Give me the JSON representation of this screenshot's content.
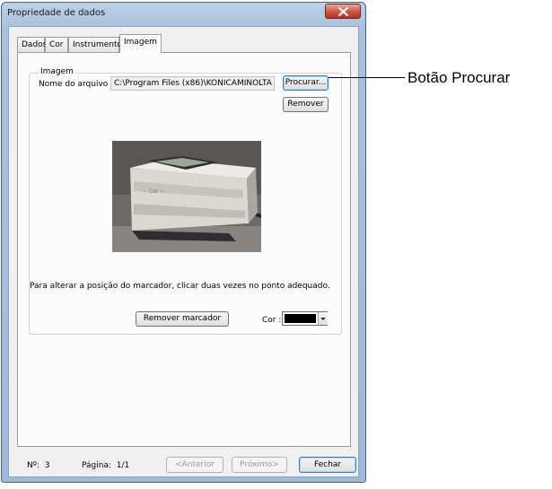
{
  "window": {
    "title": "Propriedade de dados",
    "close_icon": "close-x-icon"
  },
  "tabs": [
    {
      "label": "Dados",
      "active": false
    },
    {
      "label": "Cor",
      "active": false
    },
    {
      "label": "Instrumento",
      "active": false
    },
    {
      "label": "Imagem",
      "active": true
    }
  ],
  "image_group": {
    "label": "Imagem",
    "filename_label": "Nome do arquivo :",
    "filename_value": "C:\\Program Files (x86)\\KONICAMINOLTA",
    "browse_button": "Procurar...",
    "remove_button": "Remover",
    "preview_image": "instrument-photo",
    "hint": "Para alterar a posição do marcador, clicar duas vezes no ponto adequado.",
    "remove_marker_button": "Remover marcador",
    "color_label": "Cor :",
    "color_value": "#000000"
  },
  "footer": {
    "no_label": "Nº:",
    "no_value": "3",
    "page_label": "Página:",
    "page_value": "1/1",
    "prev_button": "<Anterior",
    "next_button": "Próximo>",
    "close_button": "Fechar"
  },
  "callout": {
    "label": "Botão Procurar"
  }
}
